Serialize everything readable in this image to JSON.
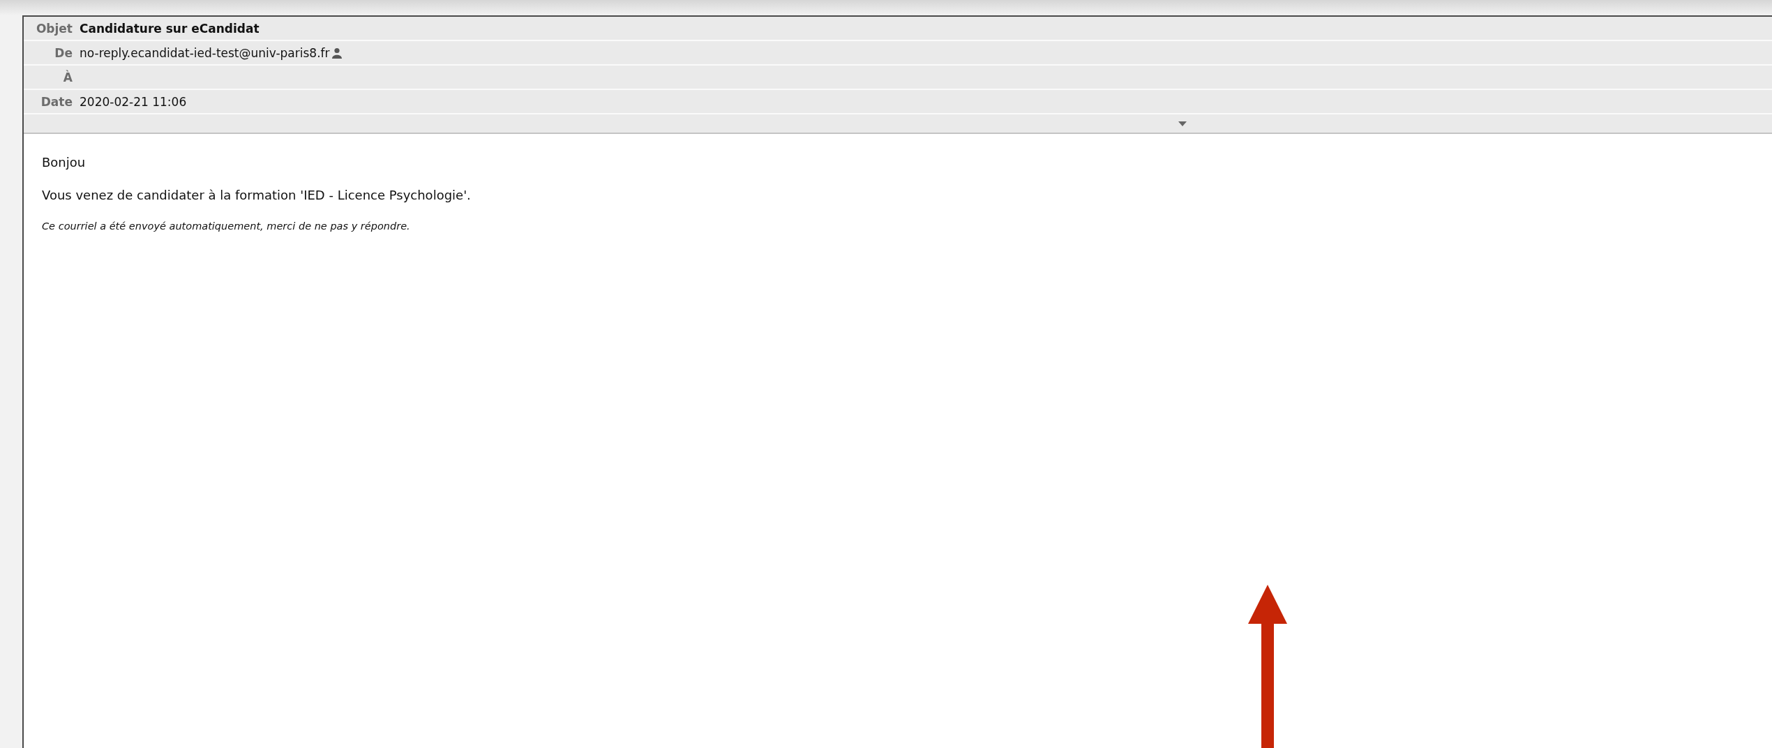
{
  "header": {
    "fields": [
      {
        "label": "Objet",
        "value": "Candidature sur eCandidat",
        "kind": "subject"
      },
      {
        "label": "De",
        "value": "no-reply.ecandidat-ied-test@univ-paris8.fr",
        "kind": "sender"
      },
      {
        "label": "À",
        "kind": "recipient"
      },
      {
        "label": "Date",
        "value": "2020-02-21 11:06",
        "kind": "date"
      }
    ]
  },
  "body": {
    "paragraphs": [
      {
        "text": "Bonjou",
        "kind": "normal"
      },
      {
        "text": "Vous venez de candidater à la formation 'IED - Licence Psychologie'.",
        "kind": "normal"
      },
      {
        "text": "Ce courriel a été envoyé automatiquement, merci de ne pas y répondre.",
        "kind": "note"
      }
    ]
  }
}
